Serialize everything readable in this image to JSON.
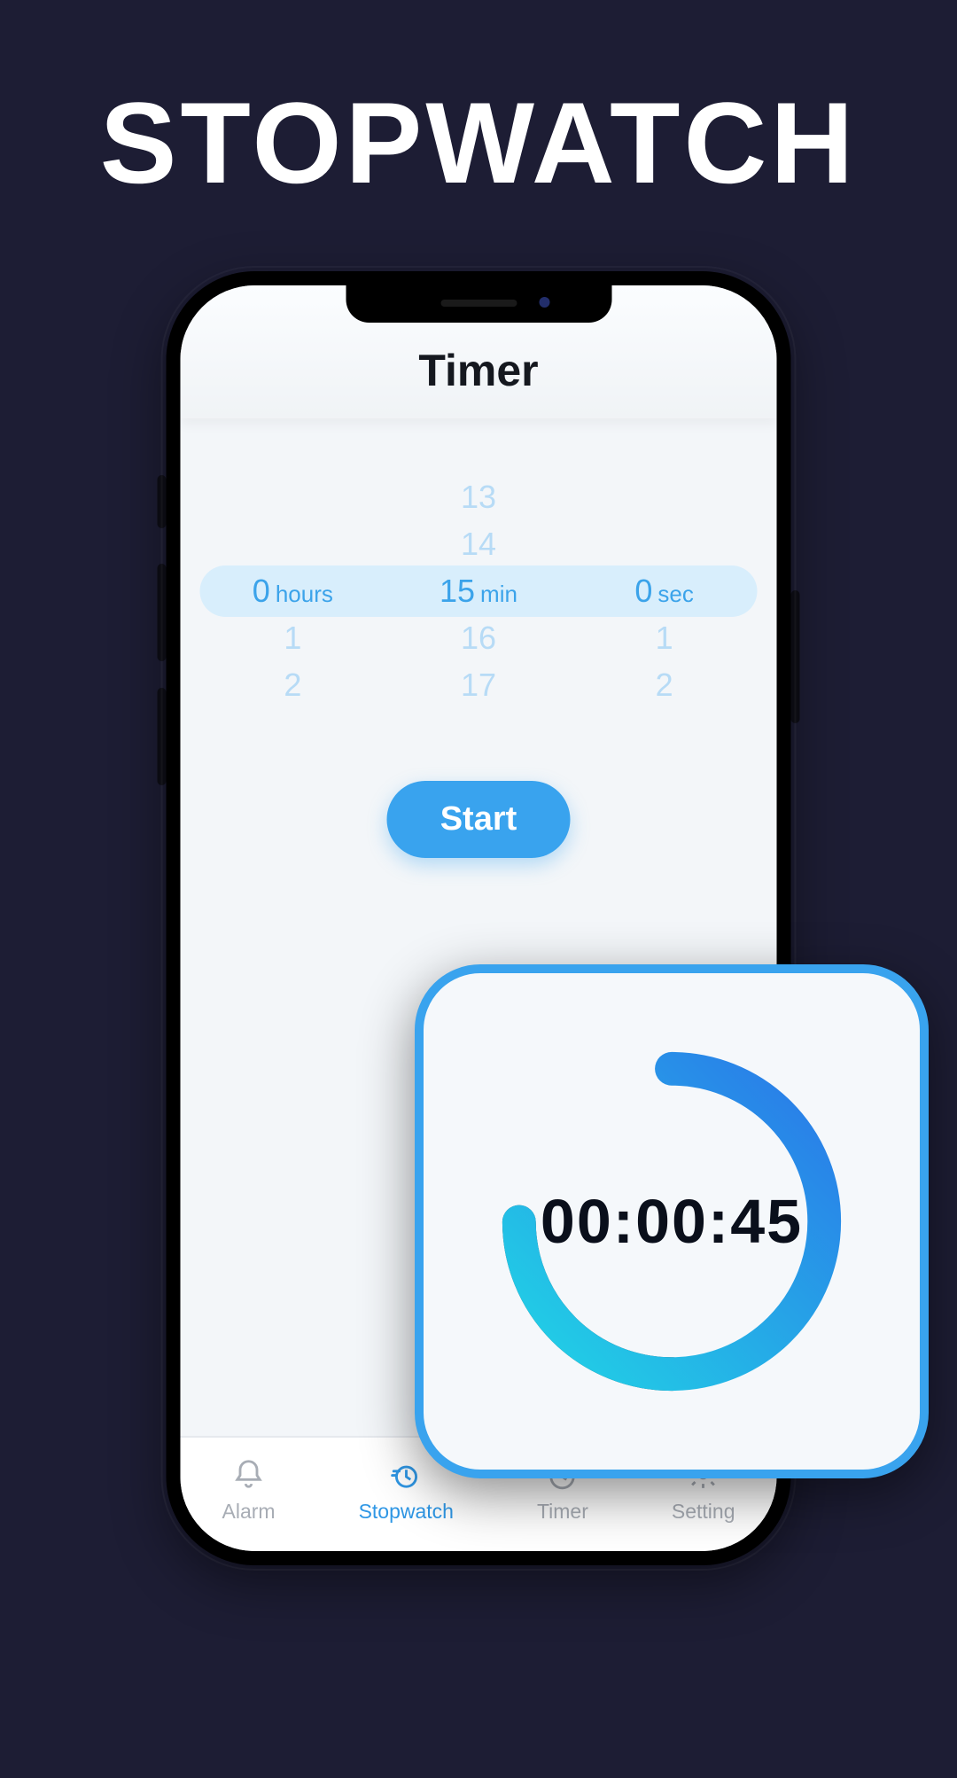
{
  "promo": {
    "title": "STOPWATCH"
  },
  "header": {
    "title": "Timer"
  },
  "picker": {
    "hours": {
      "columns": {
        "above_2": "",
        "above_1": "",
        "selected": "0",
        "unit": "hours",
        "below_1": "1",
        "below_2": "2"
      }
    },
    "minutes": {
      "columns": {
        "above_2": "13",
        "above_1": "14",
        "selected": "15",
        "unit": "min",
        "below_1": "16",
        "below_2": "17"
      }
    },
    "seconds": {
      "columns": {
        "above_2": "",
        "above_1": "",
        "selected": "0",
        "unit": "sec",
        "below_1": "1",
        "below_2": "2"
      }
    }
  },
  "actions": {
    "start": "Start"
  },
  "tabs": {
    "alarm": "Alarm",
    "stopwatch": "Stopwatch",
    "timer": "Timer",
    "setting": "Setting"
  },
  "stopwatch_card": {
    "elapsed": "00:00:45"
  }
}
